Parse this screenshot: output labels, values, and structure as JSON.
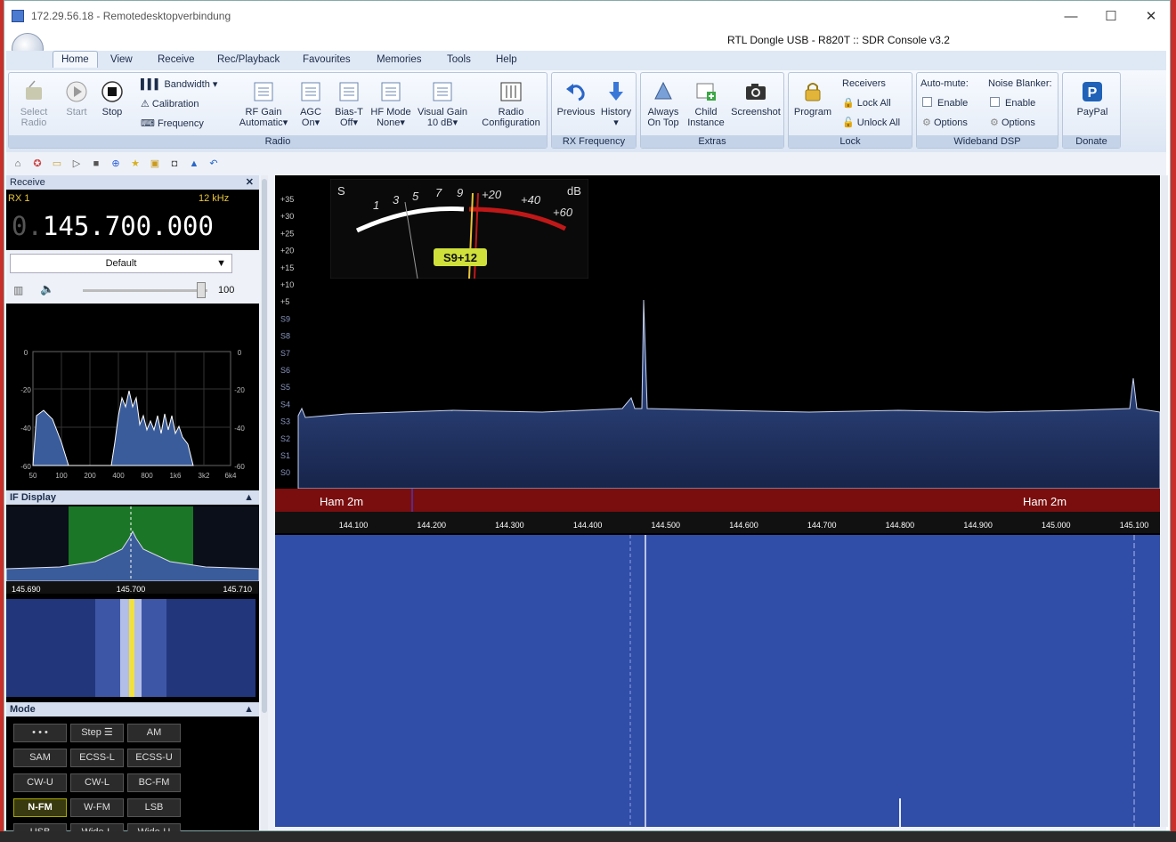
{
  "remote": {
    "title": "172.29.56.18 - Remotedesktopverbindung"
  },
  "app": {
    "title": "RTL Dongle USB - R820T :: SDR Console v3.2"
  },
  "menu": [
    "Home",
    "View",
    "Receive",
    "Rec/Playback",
    "Favourites",
    "Memories",
    "Tools",
    "Help"
  ],
  "ribbon": {
    "radio_group": "Radio",
    "select_radio": "Select Radio",
    "start": "Start",
    "stop": "Stop",
    "bandwidth": "Bandwidth",
    "calibration": "Calibration",
    "frequency": "Frequency",
    "rf_gain": "RF Gain",
    "rf_gain_val": "Automatic",
    "agc": "AGC",
    "agc_val": "On",
    "bias_t": "Bias-T",
    "bias_t_val": "Off",
    "hf_mode": "HF Mode",
    "hf_mode_val": "None",
    "visual_gain": "Visual Gain",
    "visual_gain_val": "10 dB",
    "radio_config_1": "Radio",
    "radio_config_2": "Configuration",
    "rx_group": "RX Frequency",
    "previous": "Previous",
    "history": "History",
    "extras_group": "Extras",
    "always_1": "Always",
    "always_2": "On Top",
    "child_1": "Child",
    "child_2": "Instance",
    "screenshot": "Screenshot",
    "lock_group": "Lock",
    "program": "Program",
    "receivers": "Receivers",
    "lock_all": "Lock All",
    "unlock_all": "Unlock All",
    "dsp_group": "Wideband DSP",
    "auto_mute": "Auto-mute:",
    "noise_blanker": "Noise Blanker:",
    "enable": "Enable",
    "options": "Options",
    "donate_group": "Donate",
    "paypal": "PayPal"
  },
  "receive": {
    "panel_title": "Receive",
    "rx": "RX 1",
    "bandwidth": "12 kHz",
    "freq_prefix": "0.",
    "frequency": "145.700.000",
    "filter": "Default",
    "volume": "100"
  },
  "audio_spectrum": {
    "y_ticks": [
      "0",
      "-20",
      "-40",
      "-60"
    ],
    "x_ticks": [
      "50",
      "100",
      "200",
      "400",
      "800",
      "1k6",
      "3k2",
      "6k4"
    ]
  },
  "if_display": {
    "title": "IF Display",
    "ticks": [
      "145.690",
      "145.700",
      "145.710"
    ]
  },
  "mode": {
    "title": "Mode",
    "buttons": [
      "• • •",
      "Step ☰",
      "AM",
      "SAM",
      "ECSS-L",
      "ECSS-U",
      "CW-U",
      "CW-L",
      "BC-FM",
      "N-FM",
      "W-FM",
      "LSB",
      "USB",
      "Wide-L",
      "Wide-U"
    ]
  },
  "meter": {
    "s": "S",
    "db": "dB",
    "scale_left": [
      "1",
      "3",
      "5",
      "7",
      "9"
    ],
    "scale_right": [
      "+20",
      "+40",
      "+60"
    ],
    "reading": "S9+12"
  },
  "spectrum": {
    "levels": [
      "+35",
      "+30",
      "+25",
      "+20",
      "+15",
      "+10",
      "+5",
      "S9",
      "S8",
      "S7",
      "S6",
      "S5",
      "S4",
      "S3",
      "S2",
      "S1",
      "S0"
    ],
    "band_left": "Ham 2m",
    "band_right": "Ham 2m",
    "freq_ticks": [
      "144.100",
      "144.200",
      "144.300",
      "144.400",
      "144.500",
      "144.600",
      "144.700",
      "144.800",
      "144.900",
      "145.000",
      "145.100"
    ]
  }
}
